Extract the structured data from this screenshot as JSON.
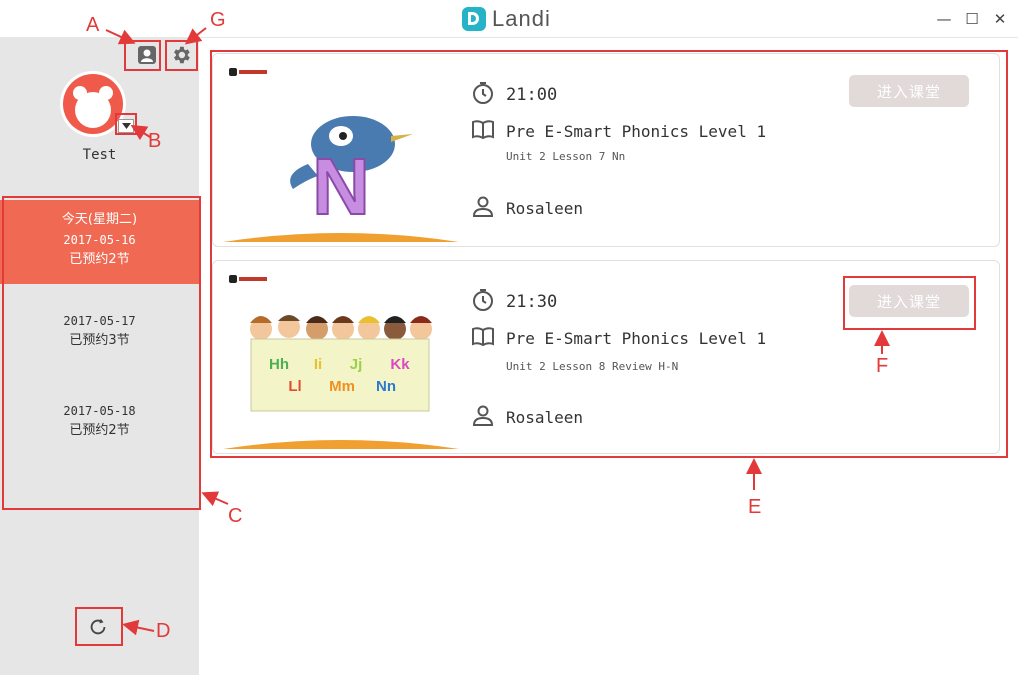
{
  "app": {
    "logo_text": "Landi"
  },
  "window_controls": {
    "minimize": "—",
    "maximize": "☐",
    "close": "✕"
  },
  "user": {
    "name": "Test"
  },
  "days": [
    {
      "day_label": "今天(星期二)",
      "date": "2017-05-16",
      "booked": "已预约2节",
      "active": true
    },
    {
      "date": "2017-05-17",
      "booked": "已预约3节"
    },
    {
      "date": "2017-05-18",
      "booked": "已预约2节"
    }
  ],
  "lessons": [
    {
      "time": "21:00",
      "course": "Pre E-Smart Phonics Level 1",
      "lesson": "Unit 2 Lesson 7 Nn",
      "teacher": "Rosaleen",
      "button": "进入课堂",
      "thumb_letters": [
        "N"
      ]
    },
    {
      "time": "21:30",
      "course": "Pre E-Smart Phonics Level 1",
      "lesson": "Unit 2 Lesson 8 Review H-N",
      "teacher": "Rosaleen",
      "button": "进入课堂",
      "thumb_letters": [
        "Hh",
        "Ii",
        "Jj",
        "Kk",
        "Ll",
        "Mm",
        "Nn"
      ]
    }
  ],
  "annotations": {
    "A": "A",
    "B": "B",
    "C": "C",
    "D": "D",
    "E": "E",
    "F": "F",
    "G": "G"
  },
  "colors": {
    "accent": "#f06a53",
    "annotation": "#e23a3a",
    "logo": "#27b3c7",
    "button_disabled": "#e2d9d9"
  },
  "icons": {
    "profile": "profile-icon",
    "settings": "gear-icon",
    "refresh": "refresh-icon",
    "clock": "clock-icon",
    "book": "book-icon",
    "person": "person-icon"
  }
}
